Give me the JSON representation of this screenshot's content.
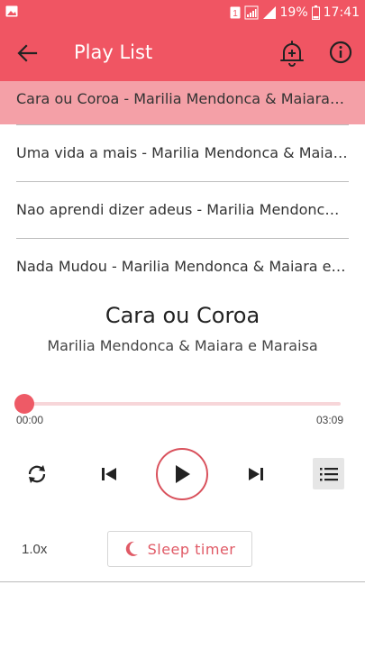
{
  "status_bar": {
    "sim_badge": "1",
    "battery_percent": "19%",
    "time": "17:41",
    "icons": [
      "image-icon",
      "signal-icon",
      "battery-icon"
    ]
  },
  "toolbar": {
    "title": "Play List",
    "icons": [
      "arrow-left-icon",
      "add-alarm-icon",
      "info-icon"
    ]
  },
  "playlist": [
    "Cara ou Coroa - Marilia Mendonca & Maiara e Maraisa",
    "Uma vida a mais - Marilia Mendonca & Maiara e Maraisa",
    "Nao aprendi dizer adeus - Marilia Mendonca & Maiara e Maraisa",
    "Nada Mudou - Marilia Mendonca & Maiara e Maraisa"
  ],
  "now_playing": {
    "title": "Cara ou Coroa",
    "artist": "Marilia Mendonca & Maiara e Maraisa",
    "current_time": "00:00",
    "total_time": "03:09",
    "progress": 0
  },
  "controls": {
    "icons": [
      "repeat-icon",
      "skip-previous-icon",
      "play-icon",
      "skip-next-icon",
      "playlist-icon"
    ]
  },
  "footer": {
    "speed": "1.0x",
    "sleep_timer": "Sleep timer"
  },
  "colors": {
    "accent": "#f05563",
    "active_row": "#f4a0a7",
    "seek_track": "#f7d6d9"
  }
}
